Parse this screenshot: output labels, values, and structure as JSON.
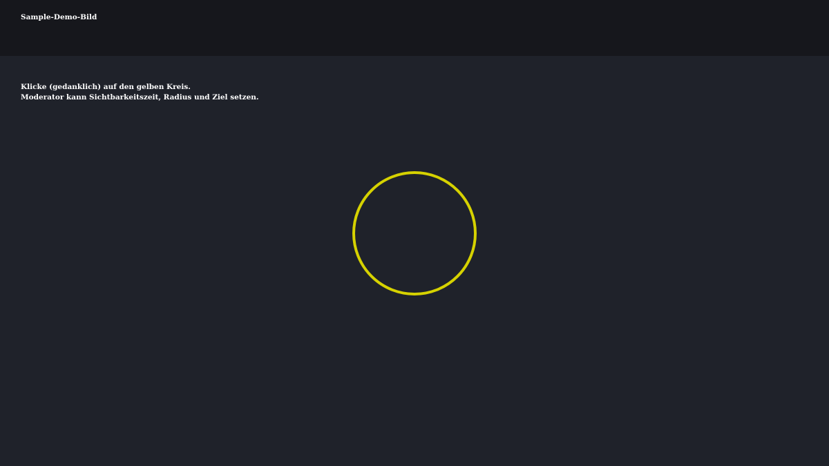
{
  "header": {
    "title": "Sample-Demo-Bild"
  },
  "instructions": {
    "line1": "Klicke (gedanklich) auf den gelben Kreis.",
    "line2": "Moderator kann Sichtbarkeitszeit, Radius und Ziel setzen."
  },
  "target": {
    "color": "#d6d200",
    "icon": "yellow-circle-target"
  }
}
